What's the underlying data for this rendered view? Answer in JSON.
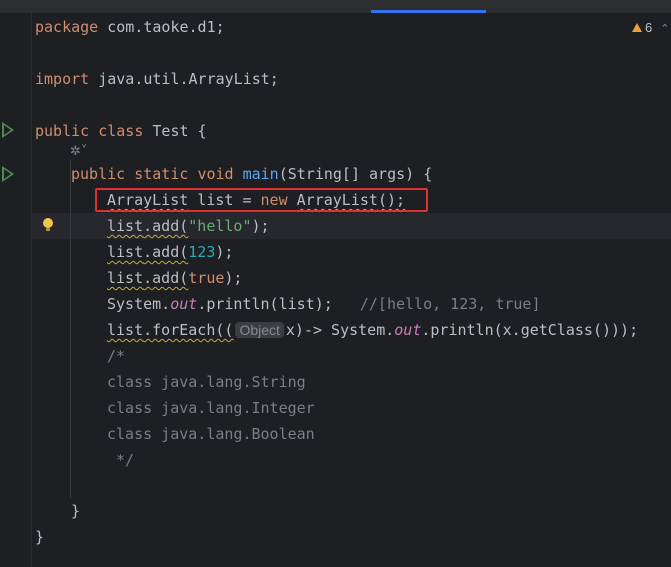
{
  "editor": {
    "warnings_count": "6",
    "lines": {
      "l1": {
        "kw": "package",
        "rest": " com.taoke.d1;"
      },
      "l3": {
        "kw": "import",
        "rest": " java.util.ArrayList;"
      },
      "l5": {
        "kw1": "public",
        "kw2": "class",
        "rest": " Test {"
      },
      "l7": {
        "kw1": "public",
        "kw2": "static",
        "kw3": "void",
        "method": "main",
        "rest": "(String[] args) {"
      },
      "l8": {
        "type": "ArrayList",
        "mid": " list = ",
        "kw": "new",
        "ctor": "ArrayList",
        "end": "();"
      },
      "l9": {
        "obj": "list",
        "call": ".add(",
        "str": "\"hello\"",
        "end": ");"
      },
      "l10": {
        "obj": "list",
        "call": ".add(",
        "num": "123",
        "end": ");"
      },
      "l11": {
        "obj": "list",
        "call": ".add(",
        "kw": "true",
        "end": ");"
      },
      "l12": {
        "pre": "System.",
        "out": "out",
        "mid": ".println(list);   ",
        "comment": "//[hello, 123, true]"
      },
      "l13": {
        "obj": "list",
        "call": ".forEach((",
        "hint": "Object",
        "mid": "x)-> System.",
        "out": "out",
        "end": ".println(x.getClass()));"
      },
      "c1": "/*",
      "c2": "class java.lang.String",
      "c3": "class java.lang.Integer",
      "c4": "class java.lang.Boolean",
      "c5": " */",
      "close_method": "}",
      "close_class": "}"
    }
  }
}
